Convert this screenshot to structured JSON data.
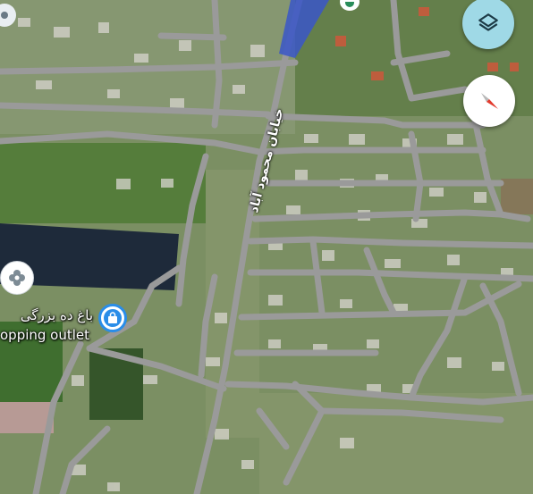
{
  "map": {
    "street_label": "خیابان محمود آباد",
    "poi": {
      "name_fa": "باغ ده بزرگی",
      "name_en": "opping outlet",
      "icon": "shopping-bag-icon"
    },
    "place_pin_icon": "flower-pin-icon"
  },
  "controls": {
    "layers_icon": "layers-icon",
    "compass_icon": "compass-icon"
  },
  "colors": {
    "road": "#9a9a9a",
    "highlight_road": "#3a56c8",
    "water": "#1e2a3a",
    "poi_blue": "#2a8de8",
    "layers_button": "#9fd9e6",
    "compass_red": "#e23b2e"
  }
}
